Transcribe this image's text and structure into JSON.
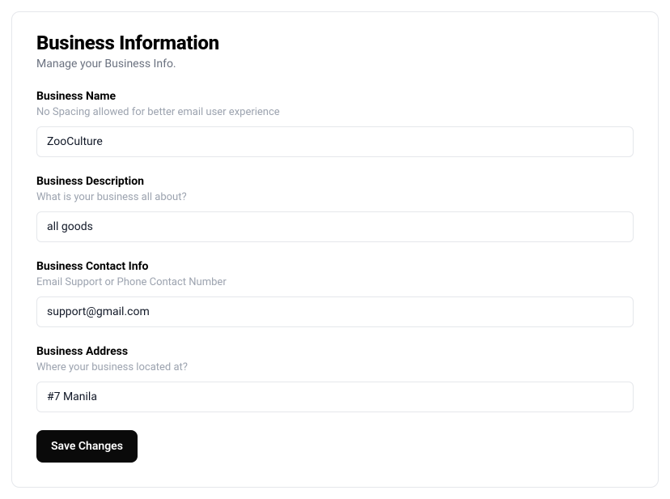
{
  "header": {
    "title": "Business Information",
    "subtitle": "Manage your Business Info."
  },
  "fields": {
    "business_name": {
      "label": "Business Name",
      "hint": "No Spacing allowed for better email user experience",
      "value": "ZooCulture"
    },
    "business_description": {
      "label": "Business Description",
      "hint": "What is your business all about?",
      "value": "all goods"
    },
    "business_contact": {
      "label": "Business Contact Info",
      "hint": "Email Support or Phone Contact Number",
      "value": "support@gmail.com"
    },
    "business_address": {
      "label": "Business Address",
      "hint": "Where your business located at?",
      "value": "#7 Manila"
    }
  },
  "actions": {
    "save_label": "Save Changes"
  }
}
